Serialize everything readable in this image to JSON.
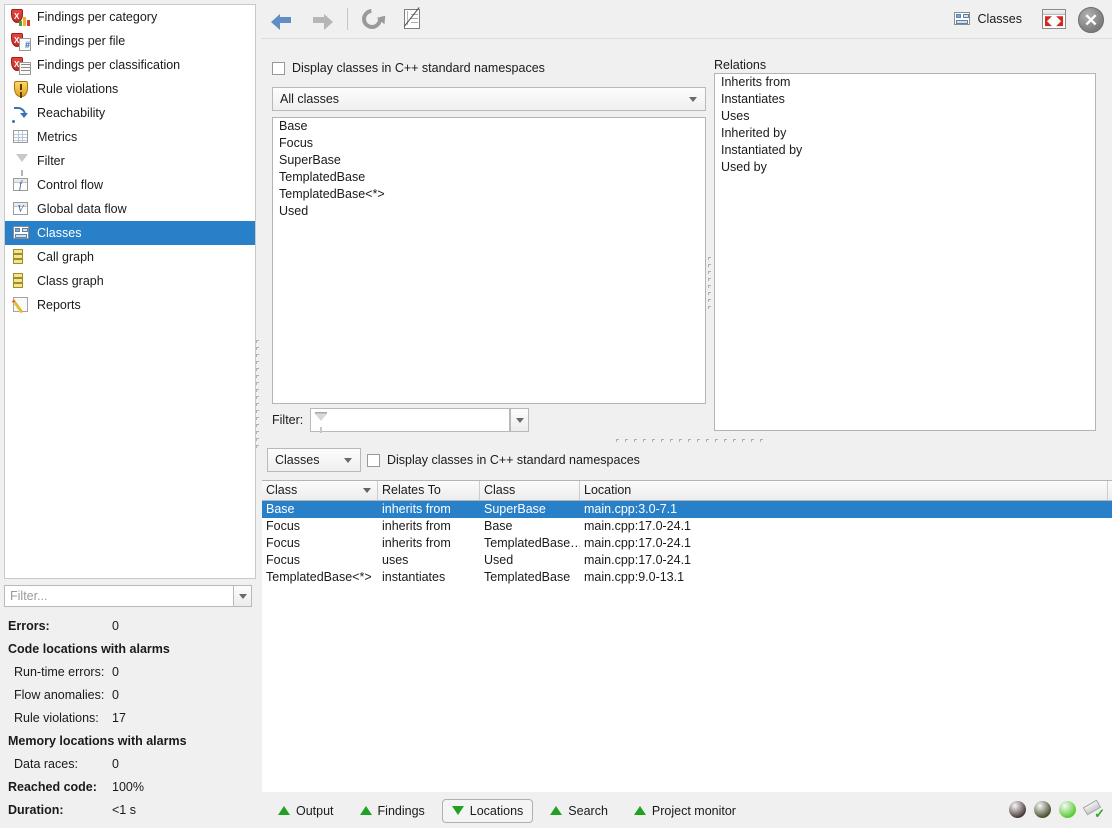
{
  "sidebar": {
    "items": [
      {
        "label": "Findings per category",
        "icon": "findings-category-icon"
      },
      {
        "label": "Findings per file",
        "icon": "findings-file-icon"
      },
      {
        "label": "Findings per classification",
        "icon": "findings-classification-icon"
      },
      {
        "label": "Rule violations",
        "icon": "rule-violations-icon"
      },
      {
        "label": "Reachability",
        "icon": "reachability-icon"
      },
      {
        "label": "Metrics",
        "icon": "metrics-icon"
      },
      {
        "label": "Filter",
        "icon": "filter-icon"
      },
      {
        "label": "Control flow",
        "icon": "control-flow-icon"
      },
      {
        "label": "Global data flow",
        "icon": "global-data-flow-icon"
      },
      {
        "label": "Classes",
        "icon": "classes-icon",
        "selected": true
      },
      {
        "label": "Call graph",
        "icon": "call-graph-icon"
      },
      {
        "label": "Class graph",
        "icon": "class-graph-icon"
      },
      {
        "label": "Reports",
        "icon": "reports-icon"
      }
    ],
    "filter": {
      "placeholder": "Filter...",
      "value": ""
    },
    "stats": [
      {
        "key": "Errors:",
        "value": "0",
        "bold": true,
        "indent": false
      },
      {
        "key": "Code locations with alarms",
        "value": "",
        "bold": true,
        "header": true
      },
      {
        "key": "Run-time errors:",
        "value": "0",
        "bold": false,
        "indent": true
      },
      {
        "key": "Flow anomalies:",
        "value": "0",
        "bold": false,
        "indent": true
      },
      {
        "key": "Rule violations:",
        "value": "17",
        "bold": false,
        "indent": true
      },
      {
        "key": "Memory locations with alarms",
        "value": "",
        "bold": true,
        "header": true
      },
      {
        "key": "Data races:",
        "value": "0",
        "bold": false,
        "indent": true
      },
      {
        "key": "Reached code:",
        "value": "100%",
        "bold": true,
        "indent": false
      },
      {
        "key": "Duration:",
        "value": "<1 s",
        "bold": true,
        "indent": false
      }
    ]
  },
  "toolbar": {
    "back_tooltip": "Back",
    "forward_tooltip": "Forward",
    "refresh_tooltip": "Refresh",
    "report_tooltip": "Report",
    "view_title": "Classes",
    "maximize_tooltip": "Maximize",
    "close_tooltip": "Close",
    "close_glyph": "✕"
  },
  "classes_panel": {
    "namespace_checkbox_label": "Display classes in C++ standard namespaces",
    "namespace_checkbox_checked": false,
    "scope_combo_value": "All classes",
    "class_list": [
      "Base",
      "Focus",
      "SuperBase",
      "TemplatedBase",
      "TemplatedBase<*>",
      "Used"
    ],
    "filter_label": "Filter:",
    "filter_value": "",
    "relations_label": "Relations",
    "relations_list": [
      "Inherits from",
      "Instantiates",
      "Uses",
      "Inherited by",
      "Instantiated by",
      "Used by"
    ]
  },
  "results_panel": {
    "mode_combo_value": "Classes",
    "namespace_checkbox_label": "Display classes in C++ standard namespaces",
    "namespace_checkbox_checked": false,
    "columns": [
      "Class",
      "Relates To",
      "Class",
      "Location"
    ],
    "sorted_column_index": 0,
    "rows": [
      {
        "class": "Base",
        "relation": "inherits from",
        "target": "SuperBase",
        "location": "main.cpp:3.0-7.1",
        "selected": true
      },
      {
        "class": "Focus",
        "relation": "inherits from",
        "target": "Base",
        "location": "main.cpp:17.0-24.1",
        "selected": false
      },
      {
        "class": "Focus",
        "relation": "inherits from",
        "target": "TemplatedBase…",
        "location": "main.cpp:17.0-24.1",
        "selected": false
      },
      {
        "class": "Focus",
        "relation": "uses",
        "target": "Used",
        "location": "main.cpp:17.0-24.1",
        "selected": false
      },
      {
        "class": "TemplatedBase<*>",
        "relation": "instantiates",
        "target": "TemplatedBase",
        "location": "main.cpp:9.0-13.1",
        "selected": false
      }
    ]
  },
  "bottom_tabs": [
    {
      "label": "Output",
      "active": false,
      "arrow": "up"
    },
    {
      "label": "Findings",
      "active": false,
      "arrow": "up"
    },
    {
      "label": "Locations",
      "active": true,
      "arrow": "down"
    },
    {
      "label": "Search",
      "active": false,
      "arrow": "up"
    },
    {
      "label": "Project monitor",
      "active": false,
      "arrow": "up"
    }
  ],
  "status_lights": [
    {
      "name": "status-light-1",
      "color": "#4a3a38"
    },
    {
      "name": "status-light-2",
      "color": "#4b5030"
    },
    {
      "name": "status-light-3",
      "color": "#57cc33"
    }
  ],
  "colors": {
    "selection_blue": "#2880c8",
    "window_bg": "#f0f0f0",
    "list_bg": "#ffffff",
    "tab_arrow_green": "#21a021"
  }
}
